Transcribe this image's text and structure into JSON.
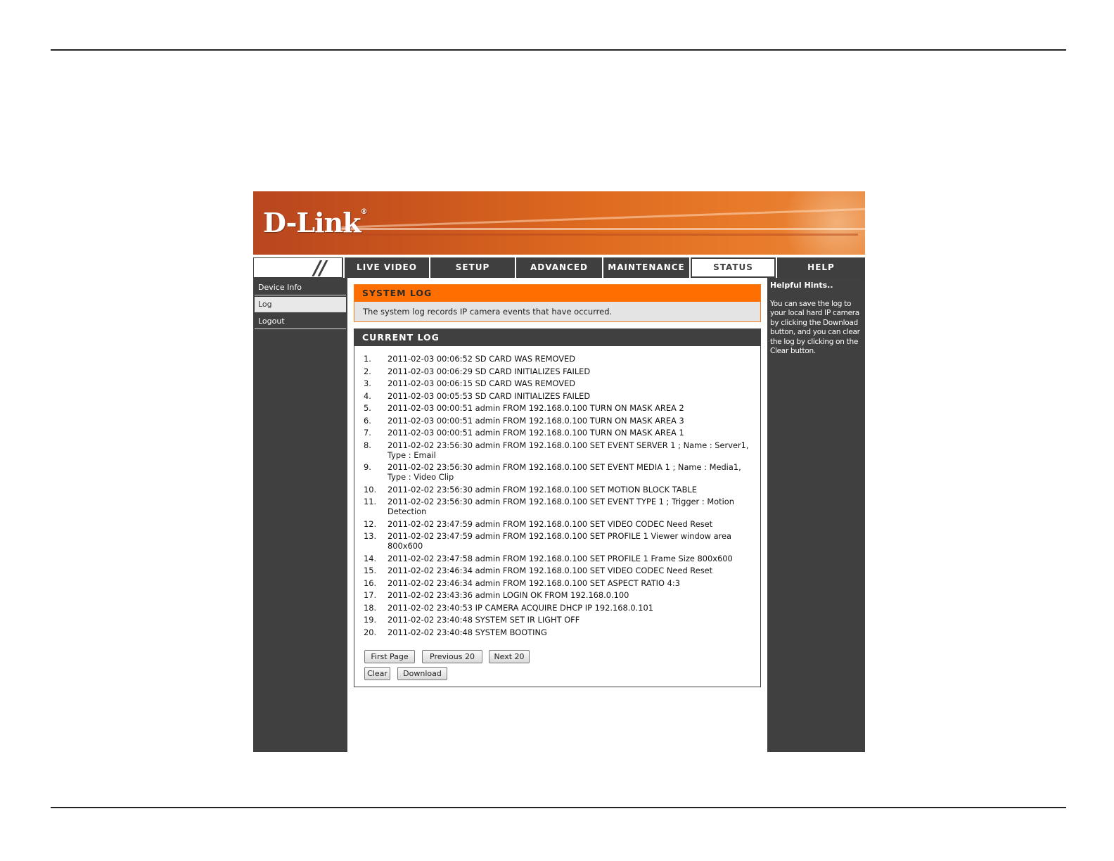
{
  "brand": {
    "logo_text": "D-Link",
    "logo_mark": "®",
    "accent": "#ff6e00",
    "dark": "#404040"
  },
  "nav": {
    "slash": "//",
    "tabs": [
      {
        "label": "LIVE VIDEO"
      },
      {
        "label": "SETUP"
      },
      {
        "label": "ADVANCED"
      },
      {
        "label": "MAINTENANCE"
      },
      {
        "label": "STATUS",
        "active": true
      },
      {
        "label": "HELP"
      }
    ]
  },
  "sidebar": {
    "items": [
      {
        "label": "Device Info"
      },
      {
        "label": "Log",
        "active": true
      },
      {
        "label": "Logout"
      }
    ]
  },
  "system_log": {
    "title": "SYSTEM LOG",
    "description": "The system log records IP camera events that have occurred."
  },
  "current_log": {
    "title": "CURRENT LOG",
    "entries": [
      {
        "num": "1.",
        "text": "2011-02-03 00:06:52 SD CARD WAS REMOVED"
      },
      {
        "num": "2.",
        "text": "2011-02-03 00:06:29 SD CARD INITIALIZES FAILED"
      },
      {
        "num": "3.",
        "text": "2011-02-03 00:06:15 SD CARD WAS REMOVED"
      },
      {
        "num": "4.",
        "text": "2011-02-03 00:05:53 SD CARD INITIALIZES FAILED"
      },
      {
        "num": "5.",
        "text": "2011-02-03 00:00:51 admin FROM 192.168.0.100 TURN ON MASK AREA 2"
      },
      {
        "num": "6.",
        "text": "2011-02-03 00:00:51 admin FROM 192.168.0.100 TURN ON MASK AREA 3"
      },
      {
        "num": "7.",
        "text": "2011-02-03 00:00:51 admin FROM 192.168.0.100 TURN ON MASK AREA 1"
      },
      {
        "num": "8.",
        "text": "2011-02-02 23:56:30 admin FROM 192.168.0.100 SET EVENT SERVER 1 ; Name : Server1, Type : Email"
      },
      {
        "num": "9.",
        "text": "2011-02-02 23:56:30 admin FROM 192.168.0.100 SET EVENT MEDIA 1 ; Name : Media1, Type : Video Clip"
      },
      {
        "num": "10.",
        "text": "2011-02-02 23:56:30 admin FROM 192.168.0.100 SET MOTION BLOCK TABLE"
      },
      {
        "num": "11.",
        "text": "2011-02-02 23:56:30 admin FROM 192.168.0.100 SET EVENT TYPE 1 ; Trigger : Motion Detection"
      },
      {
        "num": "12.",
        "text": "2011-02-02 23:47:59 admin FROM 192.168.0.100 SET VIDEO CODEC Need Reset"
      },
      {
        "num": "13.",
        "text": "2011-02-02 23:47:59 admin FROM 192.168.0.100 SET PROFILE 1 Viewer window area 800x600"
      },
      {
        "num": "14.",
        "text": "2011-02-02 23:47:58 admin FROM 192.168.0.100 SET PROFILE 1 Frame Size 800x600"
      },
      {
        "num": "15.",
        "text": "2011-02-02 23:46:34 admin FROM 192.168.0.100 SET VIDEO CODEC Need Reset"
      },
      {
        "num": "16.",
        "text": "2011-02-02 23:46:34 admin FROM 192.168.0.100 SET ASPECT RATIO 4:3"
      },
      {
        "num": "17.",
        "text": "2011-02-02 23:43:36 admin LOGIN OK FROM 192.168.0.100"
      },
      {
        "num": "18.",
        "text": "2011-02-02 23:40:53 IP CAMERA ACQUIRE DHCP IP 192.168.0.101"
      },
      {
        "num": "19.",
        "text": "2011-02-02 23:40:48 SYSTEM SET IR LIGHT OFF"
      },
      {
        "num": "20.",
        "text": "2011-02-02 23:40:48 SYSTEM BOOTING"
      }
    ],
    "buttons": {
      "first_page": "First Page",
      "previous": "Previous 20",
      "next": "Next 20",
      "clear": "Clear",
      "download": "Download"
    }
  },
  "help": {
    "title": "Helpful Hints..",
    "text": "You can save the log to your local hard IP camera by clicking the Download button, and you can clear the log by clicking on the Clear button."
  }
}
